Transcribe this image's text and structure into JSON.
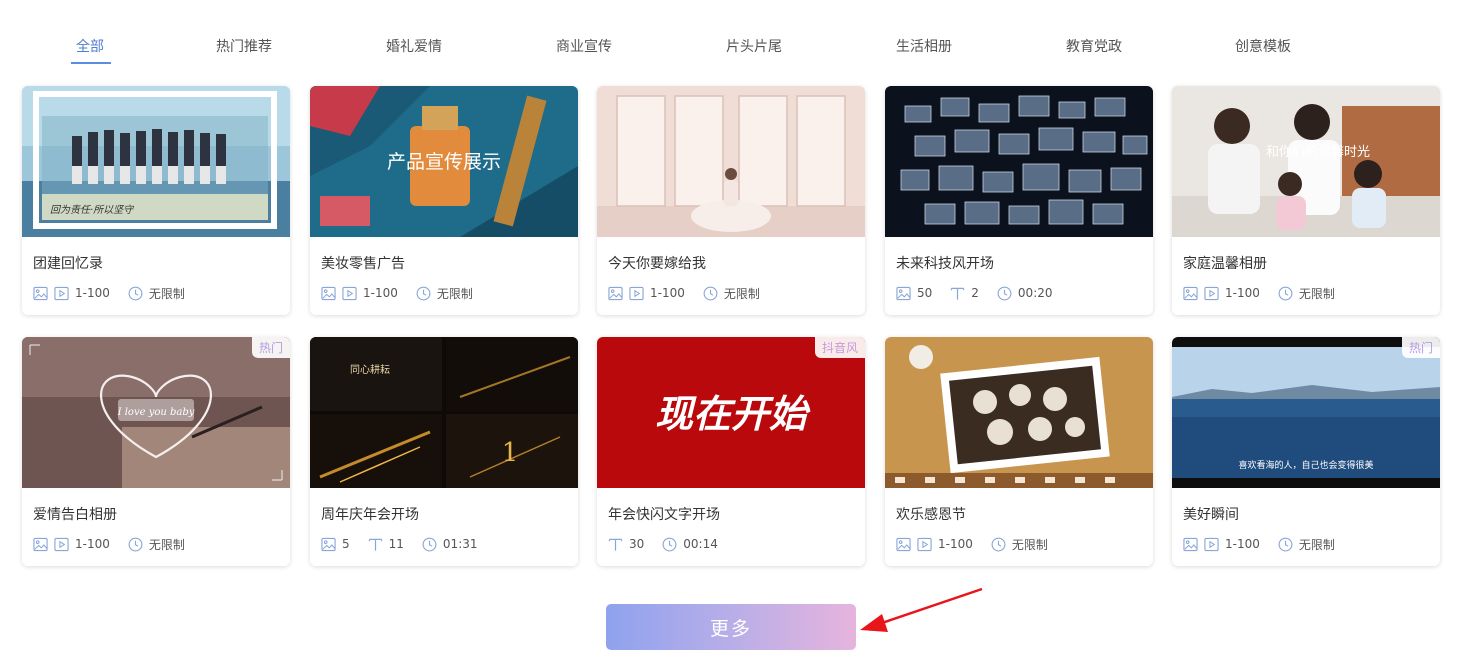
{
  "tabs": [
    {
      "label": "全部",
      "active": true
    },
    {
      "label": "热门推荐"
    },
    {
      "label": "婚礼爱情"
    },
    {
      "label": "商业宣传"
    },
    {
      "label": "片头片尾"
    },
    {
      "label": "生活相册"
    },
    {
      "label": "教育党政"
    },
    {
      "label": "创意模板"
    }
  ],
  "cards": [
    {
      "title": "团建回忆录",
      "image_count": "1-100",
      "duration": "无限制",
      "caption": "回为责任·所以坚守"
    },
    {
      "title": "美妆零售广告",
      "image_count": "1-100",
      "duration": "无限制",
      "caption": "产品宣传展示"
    },
    {
      "title": "今天你要嫁给我",
      "image_count": "1-100",
      "duration": "无限制"
    },
    {
      "title": "未来科技风开场",
      "images": "50",
      "texts": "2",
      "duration": "00:20"
    },
    {
      "title": "家庭温馨相册",
      "image_count": "1-100",
      "duration": "无限制",
      "caption": "和你们的温馨时光"
    },
    {
      "title": "爱情告白相册",
      "image_count": "1-100",
      "duration": "无限制",
      "badge": "热门",
      "caption": "I love you baby"
    },
    {
      "title": "周年庆年会开场",
      "images": "5",
      "texts": "11",
      "duration": "01:31",
      "caption": "同心耕耘",
      "digit": "1"
    },
    {
      "title": "年会快闪文字开场",
      "texts": "30",
      "duration": "00:14",
      "badge": "抖音风",
      "caption": "现在开始"
    },
    {
      "title": "欢乐感恩节",
      "image_count": "1-100",
      "duration": "无限制"
    },
    {
      "title": "美好瞬间",
      "image_count": "1-100",
      "duration": "无限制",
      "badge": "热门",
      "caption": "喜欢看海的人，自己也会变得很美"
    }
  ],
  "more_button": {
    "label": "更多"
  },
  "colors": {
    "accent": "#4f7fd1",
    "icon": "#8aa6d6",
    "hot_badge": "#b79be3",
    "arrow": "#e8151b"
  }
}
